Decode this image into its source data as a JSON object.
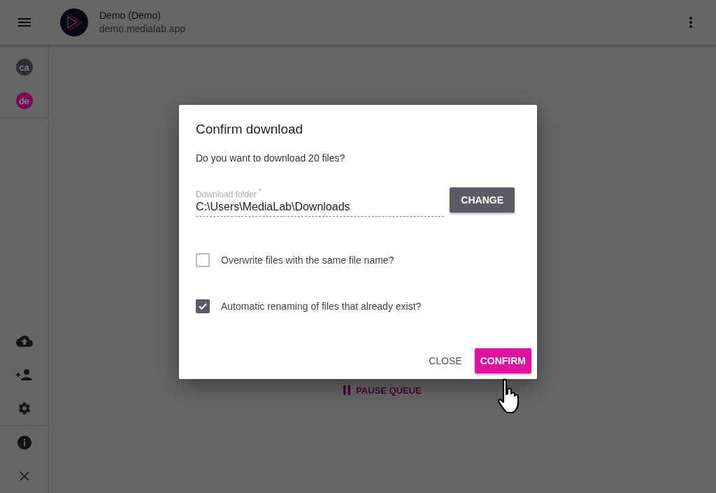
{
  "app_bar": {
    "title": "Demo (Demo)",
    "subtitle": "demo.medialab.app"
  },
  "sidebar": {
    "workspaces": [
      {
        "label": "ca",
        "color": "#2f2f33"
      },
      {
        "label": "de",
        "color": "#7a0a55"
      }
    ]
  },
  "background_button": {
    "label": "PAUSE QUEUE"
  },
  "dialog": {
    "title": "Confirm download",
    "message": "Do you want to download 20 files?",
    "folder_field": {
      "label": "Download folder",
      "required_mark": "*",
      "value": "C:\\Users\\MediaLab\\Downloads"
    },
    "change_button": "CHANGE",
    "options": [
      {
        "label": "Overwrite files with the same file name?",
        "checked": false
      },
      {
        "label": "Automatic renaming of files that already exist?",
        "checked": true
      }
    ],
    "buttons": [
      {
        "label": "CLOSE",
        "kind": "text"
      },
      {
        "label": "CONFIRM",
        "kind": "primary"
      }
    ]
  }
}
